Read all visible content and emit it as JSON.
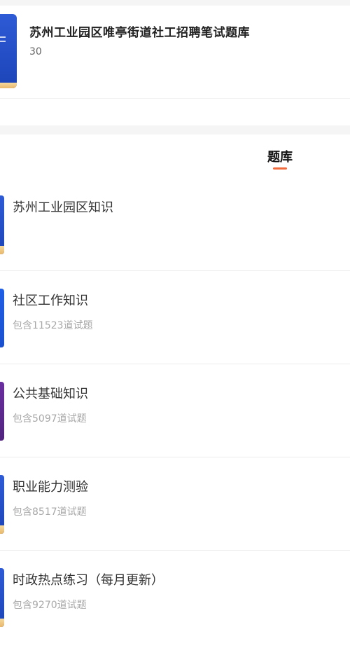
{
  "header": {
    "title": "苏州工业园区唯亭街道社工招聘笔试题库",
    "count": "30"
  },
  "tabs": [
    {
      "label": "题库",
      "active": true
    }
  ],
  "banks": [
    {
      "name": "苏州工业园区知识",
      "meta": ""
    },
    {
      "name": "社区工作知识",
      "meta": "包含11523道试题"
    },
    {
      "name": "公共基础知识",
      "meta": "包含5097道试题"
    },
    {
      "name": "职业能力测验",
      "meta": "包含8517道试题"
    },
    {
      "name": "时政热点练习（每月更新）",
      "meta": "包含9270道试题"
    }
  ],
  "colors": {
    "accent": "#f06a3c",
    "cover_blue": "#2e5bd6",
    "cover_purple": "#5a2590",
    "cover_spine": "#f0c883"
  }
}
